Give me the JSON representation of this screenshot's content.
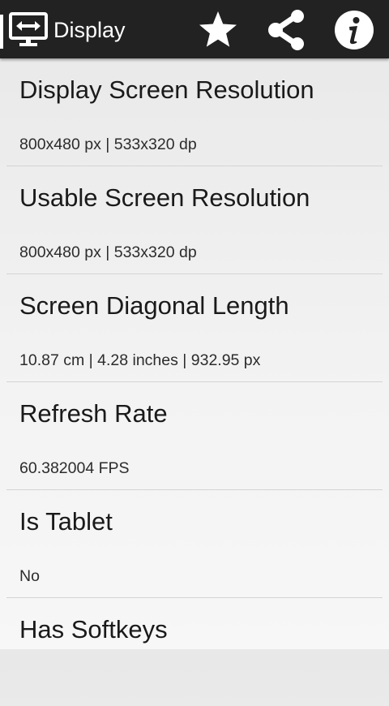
{
  "action_bar": {
    "title": "Display",
    "icons": [
      "display-icon",
      "star-icon",
      "share-icon",
      "info-icon"
    ]
  },
  "items": [
    {
      "title": "Display Screen Resolution",
      "value": "800x480 px | 533x320 dp"
    },
    {
      "title": "Usable Screen Resolution",
      "value": "800x480 px | 533x320 dp"
    },
    {
      "title": "Screen Diagonal Length",
      "value": "10.87 cm | 4.28 inches | 932.95 px"
    },
    {
      "title": "Refresh Rate",
      "value": "60.382004 FPS"
    },
    {
      "title": "Is Tablet",
      "value": "No"
    },
    {
      "title": "Has Softkeys",
      "value": ""
    }
  ],
  "colors": {
    "action_bar": "#222222",
    "title_text": "#1a1a1a",
    "value_text": "#2c2c2c"
  }
}
